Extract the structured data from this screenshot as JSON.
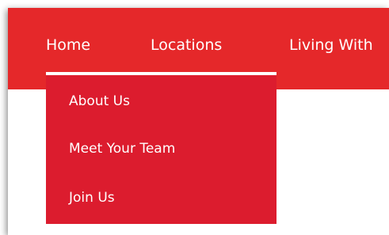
{
  "nav": {
    "items": [
      {
        "label": "Home"
      },
      {
        "label": "Locations"
      },
      {
        "label": "Living With"
      }
    ]
  },
  "dropdown": {
    "items": [
      {
        "label": "About Us"
      },
      {
        "label": "Meet Your Team"
      },
      {
        "label": "Join Us"
      }
    ]
  },
  "colors": {
    "navbar": "#e5282a",
    "dropdown": "#dc1c2e",
    "text": "#ffffff"
  }
}
